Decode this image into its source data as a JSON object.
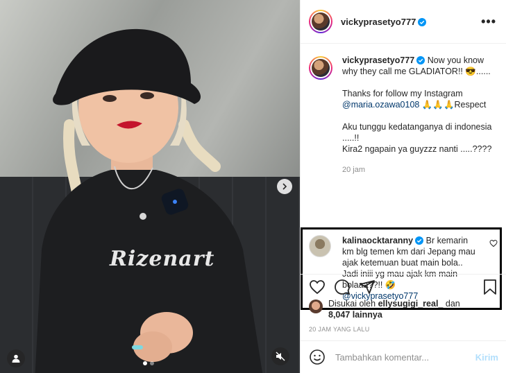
{
  "post": {
    "media": {
      "shirt_print": "Rizenart",
      "icons": {
        "next": "chevron-right-icon",
        "tags": "user-icon",
        "mute": "speaker-muted-icon"
      },
      "carousel": {
        "total": 2,
        "active": 1
      }
    },
    "header": {
      "username": "vickyprasetyo777",
      "verified": true,
      "more_label": "•••"
    },
    "caption": {
      "username": "vickyprasetyo777",
      "line1": "Now you know why they call me GLADIATOR!! 😎......",
      "line2_pre": "Thanks for follow my Instagram ",
      "mention": "@maria.ozawa0108",
      "line2_post": " 🙏🙏🙏Respect",
      "line3": "Aku tunggu kedatanganya di indonesia .....!!",
      "line4": "Kira2 ngapain ya guyzzz nanti .....????",
      "time": "20 jam"
    },
    "comment": {
      "username": "kalinaocktaranny",
      "verified": true,
      "text": "Br kemarin km blg temen km dari Jepang mau ajak ketemuan buat main bola.. Jadi iniii yg mau ajak km main bolaaa??!! 🤣",
      "mention": "@vickyprasetyo777"
    },
    "likes": {
      "prefix": "Disukai oleh ",
      "user": "ellysugigi_real_",
      "joiner": " dan",
      "count": "8,047 lainnya"
    },
    "date": "20 JAM YANG LALU",
    "add_comment": {
      "placeholder": "Tambahkan komentar...",
      "send_label": "Kirim"
    },
    "colors": {
      "verified": "#0095f6",
      "link": "#00376b",
      "send_disabled": "#b2dffc",
      "highlight_border": "#000000"
    }
  }
}
